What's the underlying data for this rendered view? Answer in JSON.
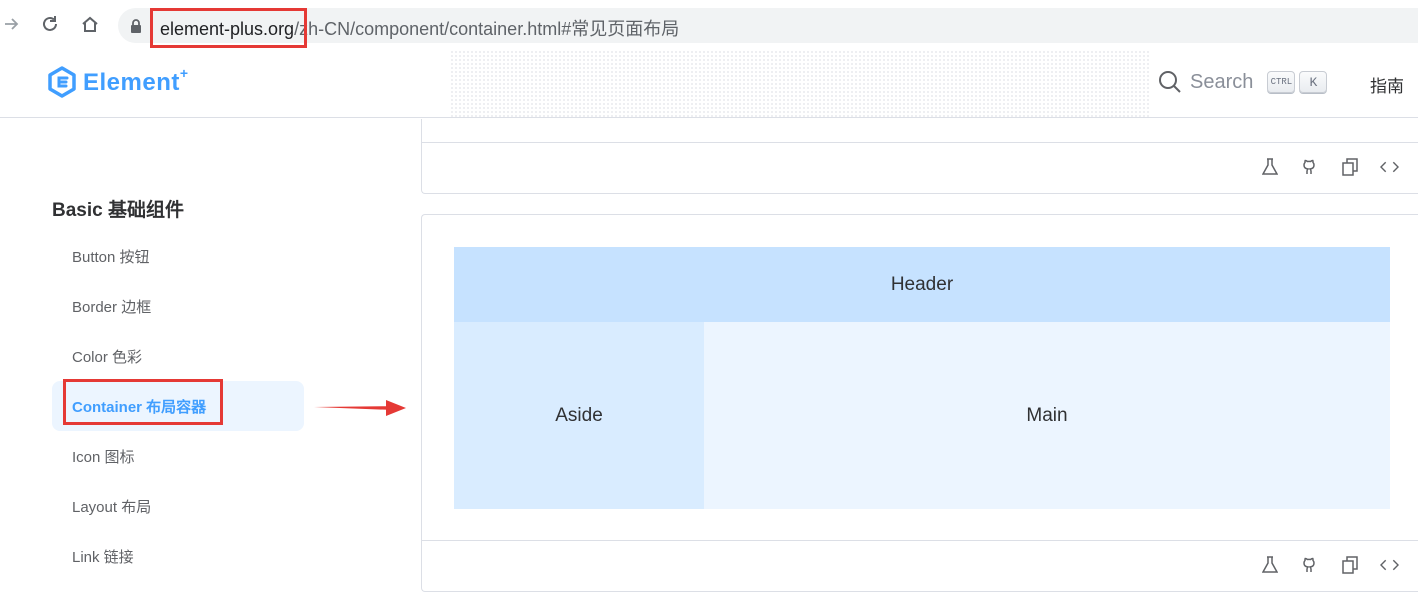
{
  "browser": {
    "url_domain": "element-plus.org",
    "url_path": "/zh-CN/component/container.html#常见页面布局"
  },
  "header": {
    "logo_text": "Element",
    "logo_sup": "+",
    "search_label": "Search",
    "kbd_ctrl": "CTRL",
    "kbd_k": "K",
    "nav_guide": "指南"
  },
  "sidebar": {
    "group_title": "Basic 基础组件",
    "items": [
      {
        "label": "Button 按钮",
        "active": false
      },
      {
        "label": "Border 边框",
        "active": false
      },
      {
        "label": "Color 色彩",
        "active": false
      },
      {
        "label": "Container 布局容器",
        "active": true
      },
      {
        "label": "Icon 图标",
        "active": false
      },
      {
        "label": "Layout 布局",
        "active": false
      },
      {
        "label": "Link 链接",
        "active": false
      }
    ]
  },
  "demo": {
    "header_label": "Header",
    "aside_label": "Aside",
    "main_label": "Main"
  },
  "colors": {
    "accent": "#409eff",
    "highlight": "#e53935",
    "header_bg": "#c6e2ff",
    "aside_bg": "#d9ecff",
    "main_bg": "#ecf5ff"
  }
}
